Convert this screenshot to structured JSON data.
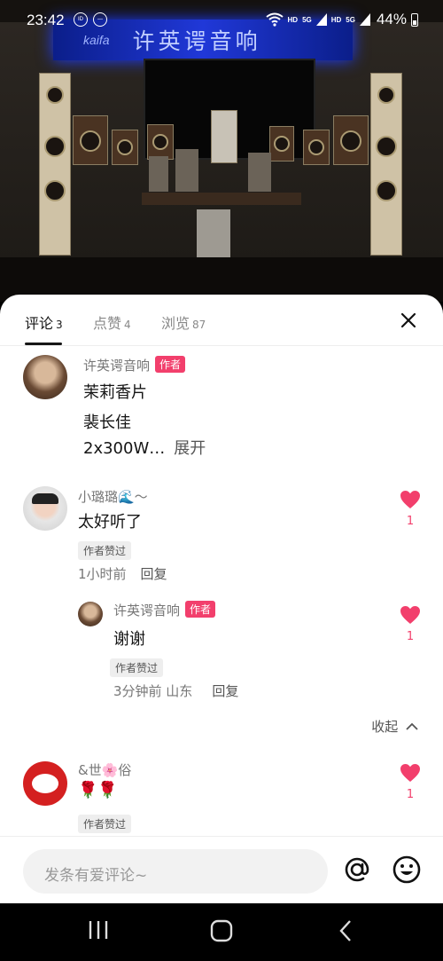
{
  "status_bar": {
    "time": "23:42",
    "left_icons": [
      "dialer-icon",
      "minus-circle-icon"
    ],
    "right_icons": [
      "wifi-icon",
      "hd-label",
      "5g-signal-icon",
      "hd-label",
      "5g-signal-icon"
    ],
    "hd": "HD",
    "fiveg": "5G",
    "battery": "44%"
  },
  "video": {
    "sign_brand": "kaifa",
    "sign_text": "许英谔音响"
  },
  "tabs": [
    {
      "label": "评论",
      "count": "3"
    },
    {
      "label": "点赞",
      "count": "4"
    },
    {
      "label": "浏览",
      "count": "87"
    }
  ],
  "comments": [
    {
      "name": "许英谔音响",
      "badge": "作者",
      "lines": [
        "茉莉香片",
        "裴长佳"
      ],
      "truncated": "2x300W…",
      "expand": "展开"
    },
    {
      "name": "小璐璐🌊〜",
      "text": "太好听了",
      "liked_tag": "作者赞过",
      "time": "1小时前",
      "reply": "回复",
      "likes": "1",
      "replies": [
        {
          "name": "许英谔音响",
          "badge": "作者",
          "text": "谢谢",
          "liked_tag": "作者赞过",
          "time": "3分钟前 山东",
          "reply": "回复",
          "likes": "1"
        }
      ],
      "collapse": "收起"
    },
    {
      "name": "&世🌸俗",
      "text": "🌹🌹",
      "liked_tag": "作者赞过",
      "likes": "1"
    }
  ],
  "input": {
    "placeholder": "发条有爱评论~"
  },
  "colors": {
    "accent": "#f23f6c",
    "like": "#f23f6c"
  }
}
